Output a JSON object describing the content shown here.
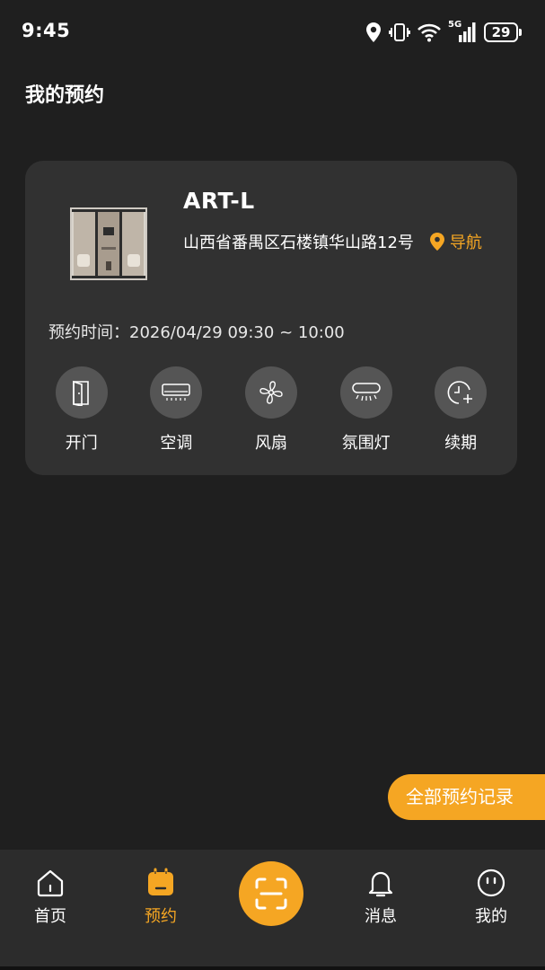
{
  "status_bar": {
    "time": "9:45",
    "battery": "29",
    "network": "5G",
    "icons": [
      "location-icon",
      "vibrate-icon",
      "wifi-icon",
      "signal-icon",
      "battery-icon"
    ]
  },
  "page": {
    "title": "我的预约"
  },
  "booking": {
    "name": "ART-L",
    "address": "山西省番禺区石楼镇华山路12号",
    "navigate_label": "导航",
    "time_label": "预约时间：",
    "time_value": "2026/04/29 09:30 ~ 10:00",
    "controls": [
      {
        "label": "开门",
        "icon": "door-icon"
      },
      {
        "label": "空调",
        "icon": "air-conditioner-icon"
      },
      {
        "label": "风扇",
        "icon": "fan-icon"
      },
      {
        "label": "氛围灯",
        "icon": "ambient-light-icon"
      },
      {
        "label": "续期",
        "icon": "renew-clock-icon"
      }
    ]
  },
  "history_button": {
    "label": "全部预约记录"
  },
  "tabbar": {
    "tabs": [
      {
        "label": "首页",
        "icon": "home-icon",
        "active": false
      },
      {
        "label": "预约",
        "icon": "calendar-icon",
        "active": true
      },
      {
        "label": "",
        "icon": "scan-icon",
        "active": false
      },
      {
        "label": "消息",
        "icon": "bell-icon",
        "active": false
      },
      {
        "label": "我的",
        "icon": "profile-icon",
        "active": false
      }
    ]
  },
  "colors": {
    "background": "#1f1f1f",
    "card": "#313131",
    "accent": "#f5a623",
    "control_circle": "#555555",
    "tabbar": "#2c2c2c"
  }
}
